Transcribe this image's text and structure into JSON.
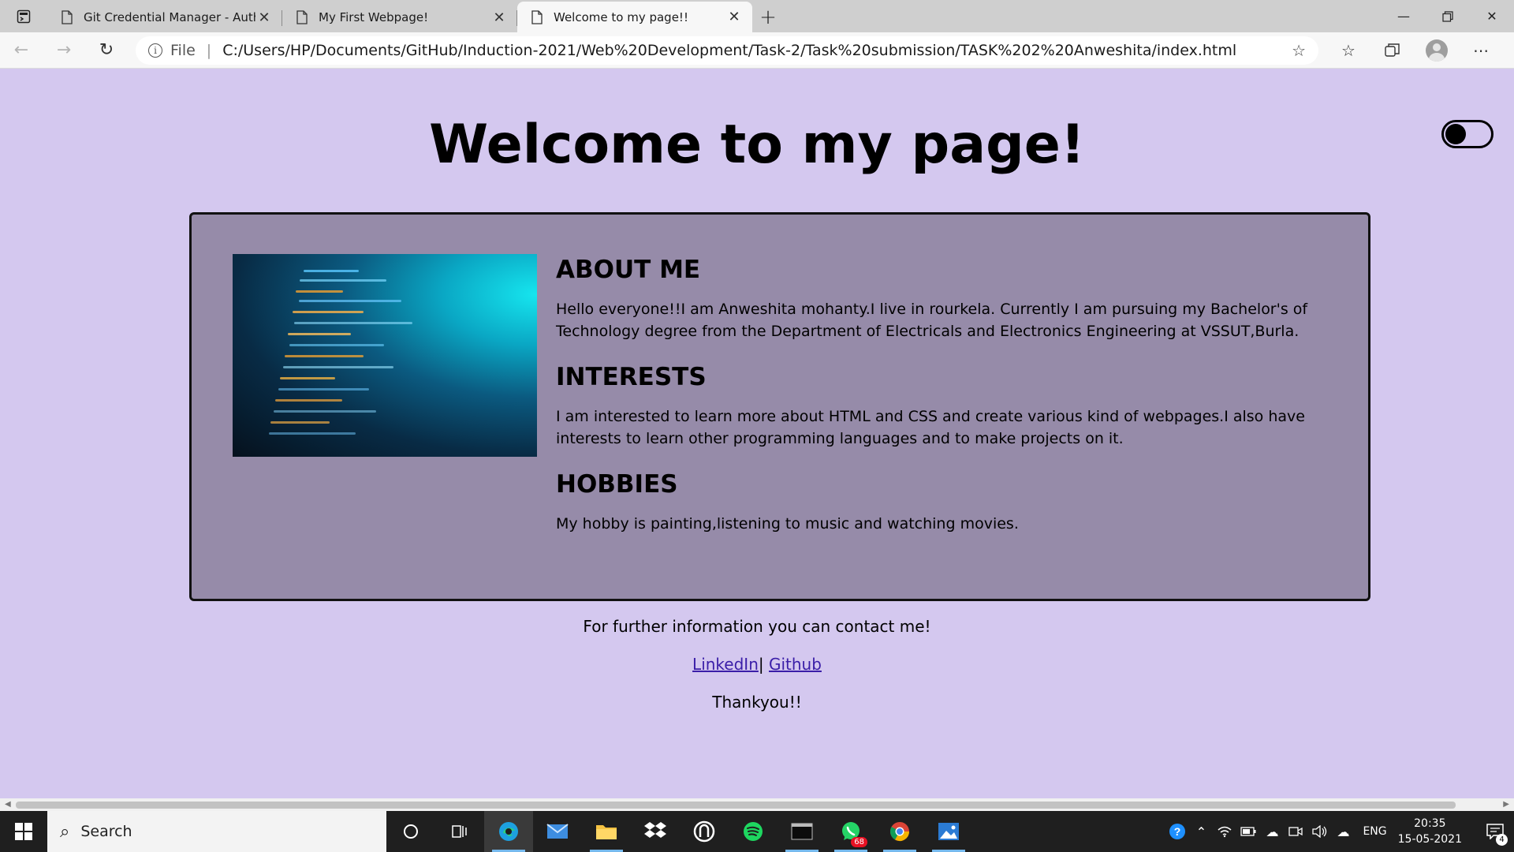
{
  "browser": {
    "tabs": [
      {
        "title": "Git Credential Manager - Authentication",
        "active": false
      },
      {
        "title": "My First Webpage!",
        "active": false
      },
      {
        "title": "Welcome to my page!!",
        "active": true
      }
    ],
    "address": {
      "scheme": "File",
      "url": "C:/Users/HP/Documents/GitHub/Induction-2021/Web%20Development/Task-2/Task%20submission/TASK%202%20Anweshita/index.html"
    }
  },
  "page": {
    "title": "Welcome to my page!",
    "sections": [
      {
        "heading": "ABOUT ME",
        "text": "Hello everyone!!I am Anweshita mohanty.I live in rourkela. Currently I am pursuing my Bachelor's of Technology degree from the Department of Electricals and Electronics Engineering at VSSUT,Burla."
      },
      {
        "heading": "INTERESTS",
        "text": "I am interested to learn more about HTML and CSS and create various kind of webpages.I also have interests to learn other programming languages and to make projects on it."
      },
      {
        "heading": "HOBBIES",
        "text": "My hobby is painting,listening to music and watching movies."
      }
    ],
    "contact_text": "For further information you can contact me!",
    "links": {
      "linkedin": "LinkedIn",
      "separator": "|",
      "github": "Github"
    },
    "thanks": "Thankyou!!"
  },
  "taskbar": {
    "search_placeholder": "Search",
    "whatsapp_badge": "68",
    "language": "ENG",
    "time": "20:35",
    "date": "15-05-2021",
    "notification_count": "4"
  },
  "colors": {
    "page_background": "#d4c8ef",
    "card_background": "#968ba9",
    "link": "#3a1ea8"
  }
}
